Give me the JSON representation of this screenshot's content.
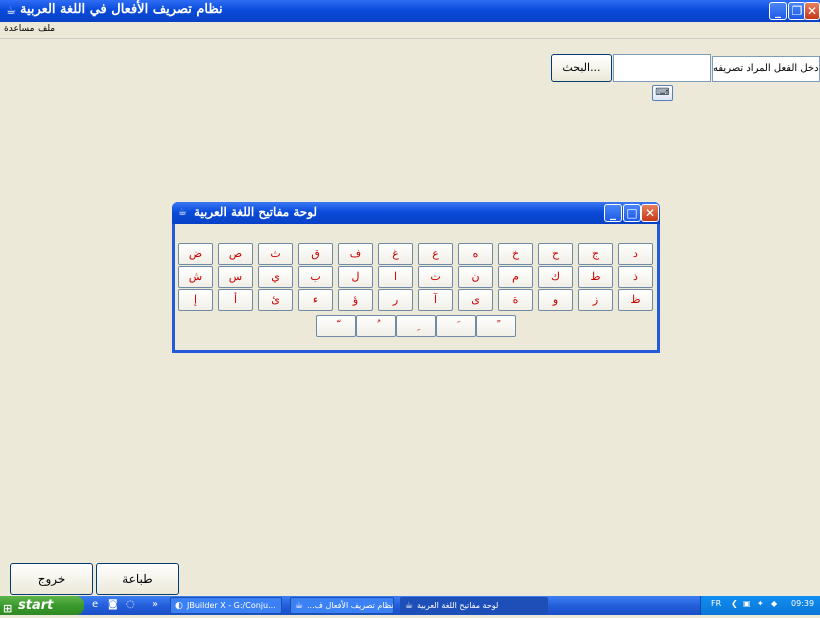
{
  "window": {
    "title": "نظام تصريف الأفعال في اللغة العربية"
  },
  "menu": {
    "help": "مساعدة",
    "file": "ملف"
  },
  "search": {
    "verb_label": "دخل الفعل المراد تصريفه :",
    "verb_value": "",
    "search_button": "البحث..."
  },
  "keyboard": {
    "title": "لوحة مفاتيح اللغة العربية",
    "rows": [
      [
        "ض",
        "ص",
        "ث",
        "ق",
        "ف",
        "غ",
        "ع",
        "ه",
        "خ",
        "ح",
        "ج",
        "د"
      ],
      [
        "ش",
        "س",
        "ي",
        "ب",
        "ل",
        "ا",
        "ت",
        "ن",
        "م",
        "ك",
        "ط",
        "ذ"
      ],
      [
        "إ",
        "أ",
        "ئ",
        "ء",
        "ؤ",
        "ر",
        "آ",
        "ى",
        "ة",
        "و",
        "ز",
        "ظ"
      ],
      [
        "ّ",
        "ُ",
        "ِ",
        "َ",
        "ً"
      ]
    ]
  },
  "buttons": {
    "print": "طباعة",
    "exit": "خروج"
  },
  "taskbar": {
    "start": "start",
    "items": [
      "JBuilder X - G:/Conju...",
      "...نظام تصريف الأفعال ف",
      "لوحة مفاتيح اللغة العربية"
    ],
    "lang": "FR",
    "time": "09:39"
  }
}
